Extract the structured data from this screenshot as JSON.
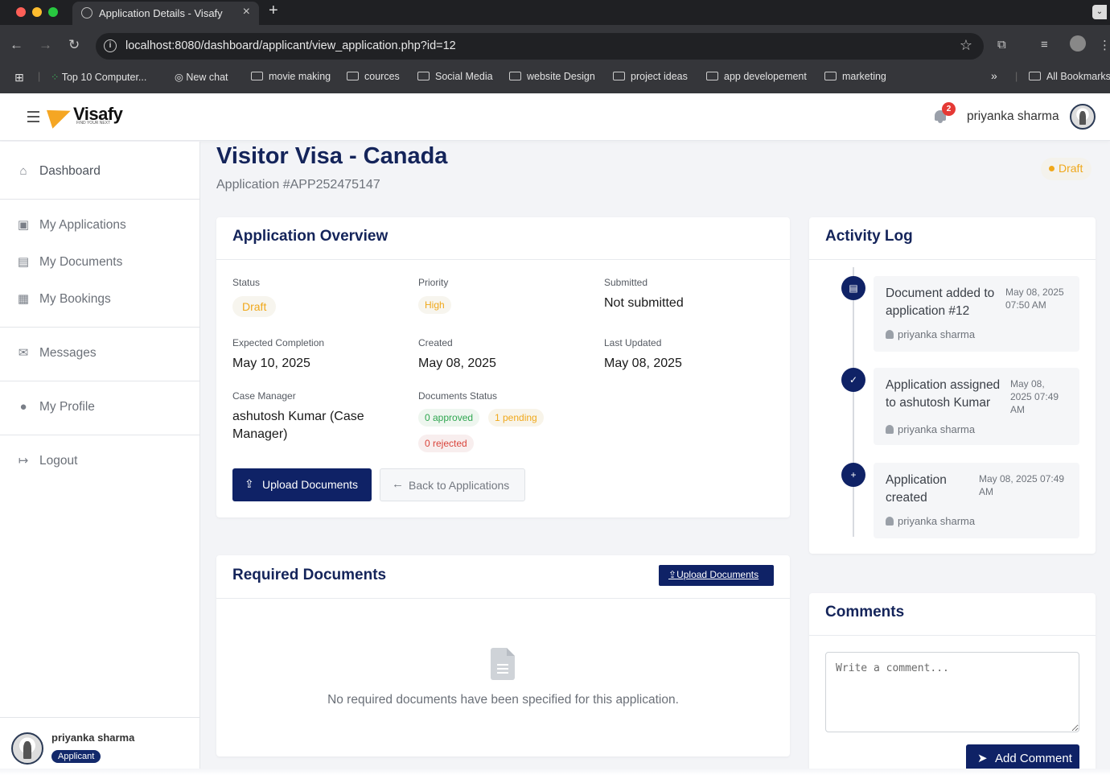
{
  "browser": {
    "tab_title": "Application Details - Visafy",
    "url": "localhost:8080/dashboard/applicant/view_application.php?id=12",
    "bookmarks": [
      "Top 10 Computer...",
      "New chat",
      "movie making",
      "cources",
      "Social Media",
      "website Design",
      "project ideas",
      "app developement",
      "marketing"
    ],
    "all_bookmarks": "All Bookmarks",
    "more_bookmarks": "»"
  },
  "header": {
    "brand": "Visafy",
    "tagline": "FIND YOUR NEXT",
    "notification_count": "2",
    "user_name": "priyanka sharma"
  },
  "sidebar": {
    "items": [
      {
        "label": "Dashboard",
        "icon": "home-icon"
      },
      {
        "label": "My Applications",
        "icon": "passport-icon"
      },
      {
        "label": "My Documents",
        "icon": "file-icon"
      },
      {
        "label": "My Bookings",
        "icon": "calendar-icon"
      },
      {
        "label": "Messages",
        "icon": "envelope-icon"
      },
      {
        "label": "My Profile",
        "icon": "user-icon"
      },
      {
        "label": "Logout",
        "icon": "sign-out-icon"
      }
    ],
    "footer_name": "priyanka sharma",
    "footer_role": "Applicant"
  },
  "page": {
    "title": "Visitor Visa - Canada",
    "app_number": "Application #APP252475147",
    "status_pill": "Draft"
  },
  "overview": {
    "title": "Application Overview",
    "status_label": "Status",
    "status_value": "Draft",
    "priority_label": "Priority",
    "priority_value": "High",
    "submitted_label": "Submitted",
    "submitted_value": "Not submitted",
    "expected_label": "Expected Completion",
    "expected_value": "May 10, 2025",
    "created_label": "Created",
    "created_value": "May 08, 2025",
    "updated_label": "Last Updated",
    "updated_value": "May 08, 2025",
    "manager_label": "Case Manager",
    "manager_value": "ashutosh Kumar (Case Manager)",
    "docs_status_label": "Documents Status",
    "docs_approved": "0 approved",
    "docs_pending": "1 pending",
    "docs_rejected": "0 rejected",
    "upload_button": "Upload Documents",
    "back_button": "Back to Applications"
  },
  "required_docs": {
    "title": "Required Documents",
    "upload_button": "Upload Documents",
    "empty_message": "No required documents have been specified for this application."
  },
  "activity": {
    "title": "Activity Log",
    "entries": [
      {
        "text": "Document added to application #12",
        "date": "May 08, 2025 07:50 AM",
        "user": "priyanka sharma",
        "icon": "file-upload-icon"
      },
      {
        "text": "Application assigned to ashutosh Kumar",
        "date": "May 08, 2025 07:49 AM",
        "user": "priyanka sharma",
        "icon": "user-check-icon"
      },
      {
        "text": "Application created",
        "date": "May 08, 2025 07:49 AM",
        "user": "priyanka sharma",
        "icon": "plus-circle-icon"
      }
    ]
  },
  "comments": {
    "title": "Comments",
    "placeholder": "Write a comment...",
    "add_button": "Add Comment"
  },
  "colors": {
    "navy": "#0f2266",
    "title": "#14245a",
    "draft": "#f0a81b",
    "approved": "#2fa650",
    "rejected": "#d9443b",
    "badge": "#e53935"
  }
}
